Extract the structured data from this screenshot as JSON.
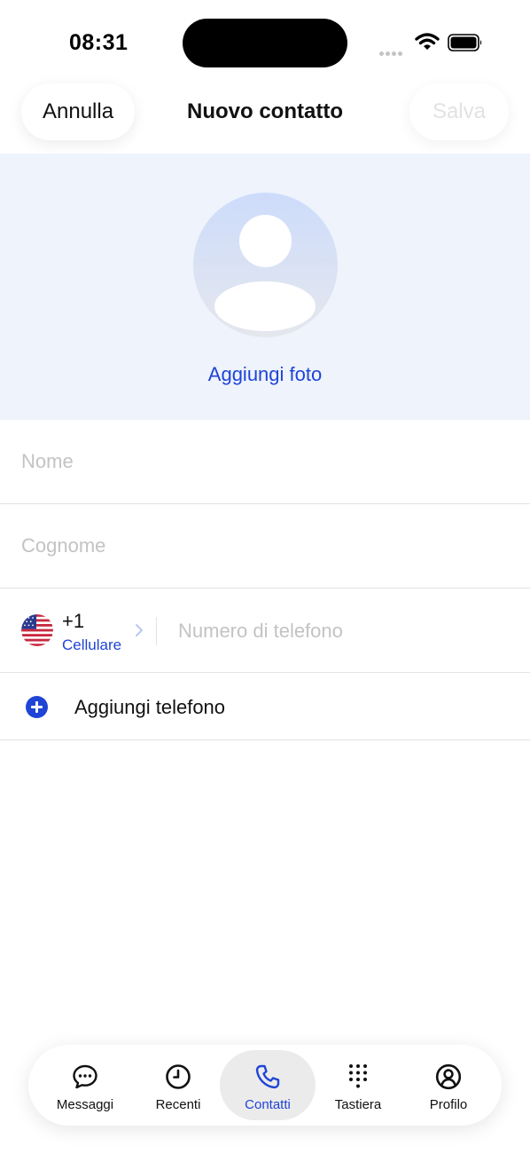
{
  "status_bar": {
    "time": "08:31"
  },
  "header": {
    "cancel_label": "Annulla",
    "title": "Nuovo contatto",
    "save_label": "Salva"
  },
  "photo": {
    "add_photo_label": "Aggiungi foto"
  },
  "form": {
    "first_name_placeholder": "Nome",
    "last_name_placeholder": "Cognome",
    "phone": {
      "flag_icon": "us-flag-icon",
      "country_code": "+1",
      "type_label": "Cellulare",
      "number_placeholder": "Numero di telefono"
    },
    "add_phone_label": "Aggiungi telefono"
  },
  "tab_bar": {
    "tabs": [
      {
        "label": "Messaggi",
        "icon": "chat-bubble-icon",
        "active": false
      },
      {
        "label": "Recenti",
        "icon": "clock-icon",
        "active": false
      },
      {
        "label": "Contatti",
        "icon": "phone-icon",
        "active": true
      },
      {
        "label": "Tastiera",
        "icon": "keypad-icon",
        "active": false
      },
      {
        "label": "Profilo",
        "icon": "profile-icon",
        "active": false
      }
    ]
  },
  "colors": {
    "accent": "#1f44d6",
    "photo_background": "#eef3fc",
    "placeholder": "#c3c3c3",
    "divider": "#e3e3e3"
  }
}
